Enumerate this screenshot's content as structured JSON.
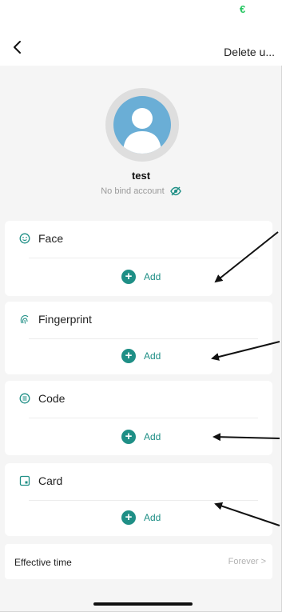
{
  "status_bar": {
    "glyph": "€"
  },
  "nav": {
    "back_icon": "chevron-left-icon",
    "delete_label": "Delete u..."
  },
  "profile": {
    "name": "test",
    "bind_text": "No bind account",
    "bind_icon": "eye-off-icon"
  },
  "credentials": [
    {
      "title": "Face",
      "icon": "face-icon",
      "add_label": "Add"
    },
    {
      "title": "Fingerprint",
      "icon": "fingerprint-icon",
      "add_label": "Add"
    },
    {
      "title": "Code",
      "icon": "code-icon",
      "add_label": "Add"
    },
    {
      "title": "Card",
      "icon": "card-icon",
      "add_label": "Add"
    }
  ],
  "effective": {
    "label": "Effective time",
    "value": "Forever >"
  },
  "colors": {
    "accent": "#1f8f86",
    "status_green": "#22c55e",
    "avatar": "#6aaed6"
  }
}
